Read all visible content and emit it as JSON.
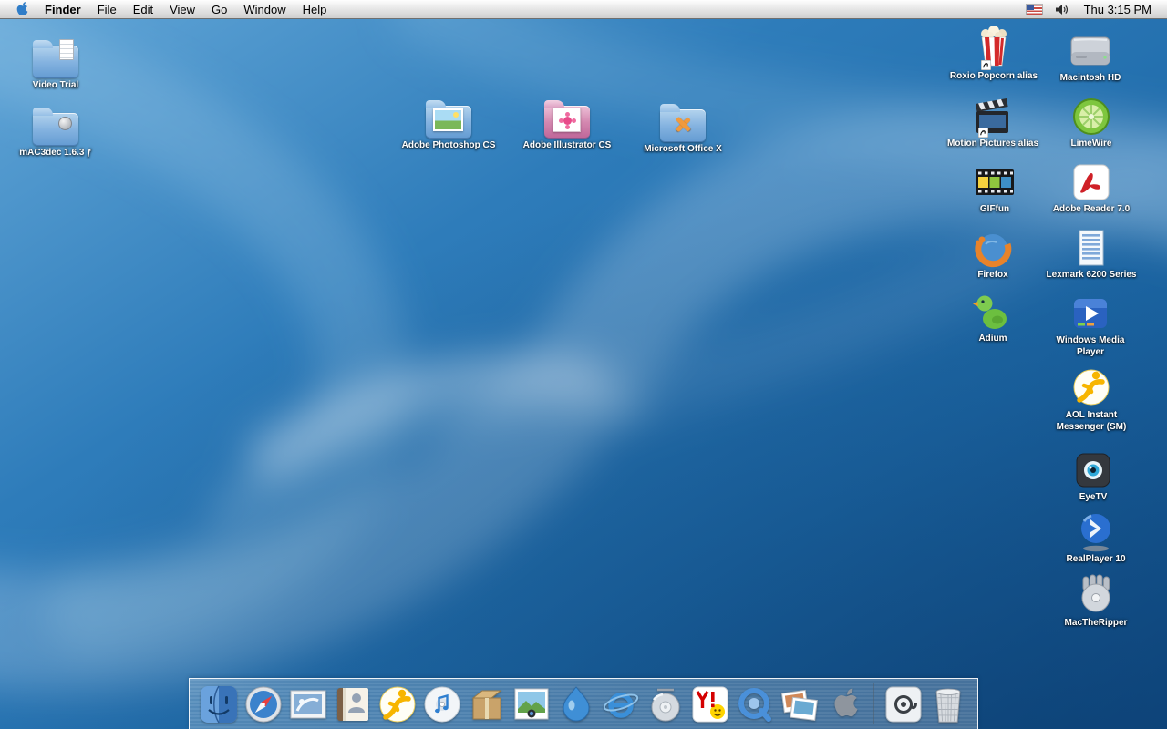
{
  "menubar": {
    "app_menu": "Finder",
    "menus": [
      "File",
      "Edit",
      "View",
      "Go",
      "Window",
      "Help"
    ],
    "clock": "Thu 3:15 PM",
    "status_icons": [
      "us-flag-input-menu",
      "volume-speaker"
    ]
  },
  "desktop": {
    "wallpaper": "aqua-blue-swirl",
    "icons": [
      {
        "label": "Video Trial",
        "icon": "folder-with-document"
      },
      {
        "label": "mAC3dec 1.6.3 ƒ",
        "icon": "folder-with-gadget"
      },
      {
        "label": "Adobe Photoshop CS",
        "icon": "folder-with-photo"
      },
      {
        "label": "Adobe Illustrator CS",
        "icon": "folder-with-flower"
      },
      {
        "label": "Microsoft Office X",
        "icon": "folder-with-x"
      },
      {
        "label": "Roxio Popcorn alias",
        "icon": "popcorn-box-alias"
      },
      {
        "label": "Macintosh HD",
        "icon": "hard-drive"
      },
      {
        "label": "Motion Pictures alias",
        "icon": "film-clapperboard-alias"
      },
      {
        "label": "LimeWire",
        "icon": "lime-slice"
      },
      {
        "label": "GIFfun",
        "icon": "film-strip"
      },
      {
        "label": "Adobe Reader 7.0",
        "icon": "adobe-reader-swoosh"
      },
      {
        "label": "Firefox",
        "icon": "firefox-globe"
      },
      {
        "label": "Lexmark 6200 Series",
        "icon": "printer-document"
      },
      {
        "label": "Adium",
        "icon": "green-duck"
      },
      {
        "label": "Windows Media Player",
        "icon": "media-player-play"
      },
      {
        "label": "AOL Instant Messenger (SM)",
        "icon": "aim-running-man"
      },
      {
        "label": "EyeTV",
        "icon": "eyetv-eye"
      },
      {
        "label": "RealPlayer 10",
        "icon": "realplayer-sphere"
      },
      {
        "label": "MacTheRipper",
        "icon": "hand-on-disc"
      }
    ]
  },
  "dock": {
    "items": [
      "Finder",
      "Safari",
      "Mail",
      "Address Book",
      "AIM",
      "iTunes",
      "Package",
      "iPhoto",
      "Sherlock",
      "Internet Explorer",
      "DVD Player",
      "Yahoo! Messenger",
      "QuickTime Player",
      "Image Capture",
      "Apple",
      "Mail @",
      "Trash"
    ]
  }
}
